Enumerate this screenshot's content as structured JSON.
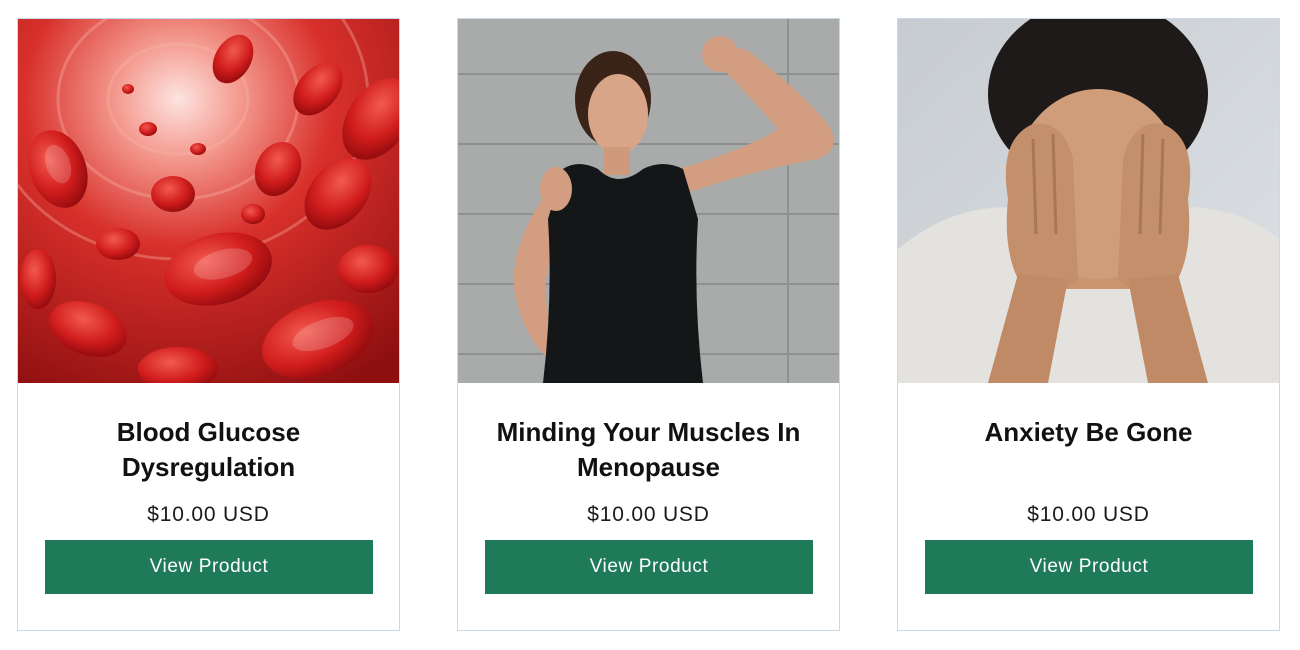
{
  "products": [
    {
      "title": "Blood Glucose Dysregulation",
      "price": "$10.00 USD",
      "button_label": "View Product",
      "image": "red-blood-cells-image"
    },
    {
      "title": "Minding Your Muscles In Menopause",
      "price": "$10.00 USD",
      "button_label": "View Product",
      "image": "woman-flexing-arm-image"
    },
    {
      "title": "Anxiety Be Gone",
      "price": "$10.00 USD",
      "button_label": "View Product",
      "image": "woman-covering-face-image"
    }
  ],
  "colors": {
    "button_bg": "#1f7a5a",
    "card_border": "#c9d9e8"
  }
}
